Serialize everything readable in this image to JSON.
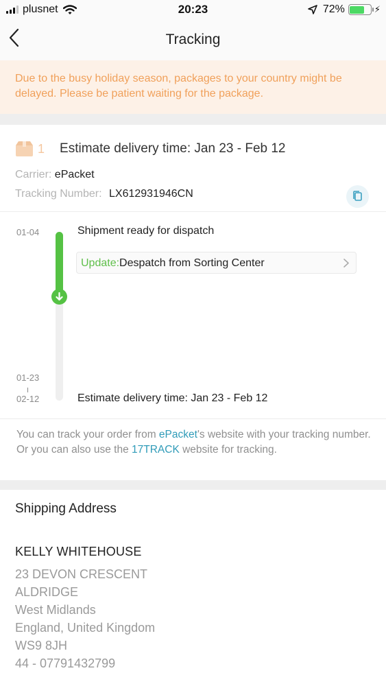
{
  "status_bar": {
    "carrier": "plusnet",
    "time": "20:23",
    "battery": "72%",
    "battery_level": 0.72
  },
  "nav": {
    "title": "Tracking"
  },
  "banner": {
    "text": "Due to the busy holiday season, packages to your country might be delayed. Please be patient waiting for the package."
  },
  "package": {
    "count": "1",
    "estimate": "Estimate delivery time: Jan 23 - Feb 12",
    "carrier_label": "Carrier:",
    "carrier_value": "ePacket",
    "tracking_label": "Tracking Number:",
    "tracking_value": "LX612931946CN"
  },
  "timeline": {
    "date_start": "01-04",
    "date_mid": "01-23",
    "date_end": "02-12",
    "event": "Shipment ready for dispatch",
    "update_prefix": "Update:",
    "update_text": "Despatch from Sorting Center",
    "estimate": "Estimate delivery time: Jan 23 - Feb 12"
  },
  "help": {
    "part1": "You can track your order from ",
    "link1": "ePacket",
    "part2": "'s website with your tracking number. Or you can also use the ",
    "link2": "17TRACK",
    "part3": " website for tracking."
  },
  "address": {
    "title": "Shipping Address",
    "name": "KELLY WHITEHOUSE",
    "lines": [
      "23 DEVON CRESCENT",
      "ALDRIDGE",
      "West Midlands",
      "England, United Kingdom",
      "WS9 8JH",
      "44 - 07791432799"
    ]
  },
  "colors": {
    "accent_orange": "#f0a05a",
    "progress_green": "#55c244",
    "link_teal": "#2f9bb8"
  },
  "icons": [
    "back-chevron-icon",
    "box-icon",
    "copy-icon",
    "arrow-down-icon",
    "chevron-right-icon",
    "wifi-icon",
    "location-arrow-icon",
    "battery-icon",
    "charging-bolt-icon",
    "signal-icon"
  ]
}
